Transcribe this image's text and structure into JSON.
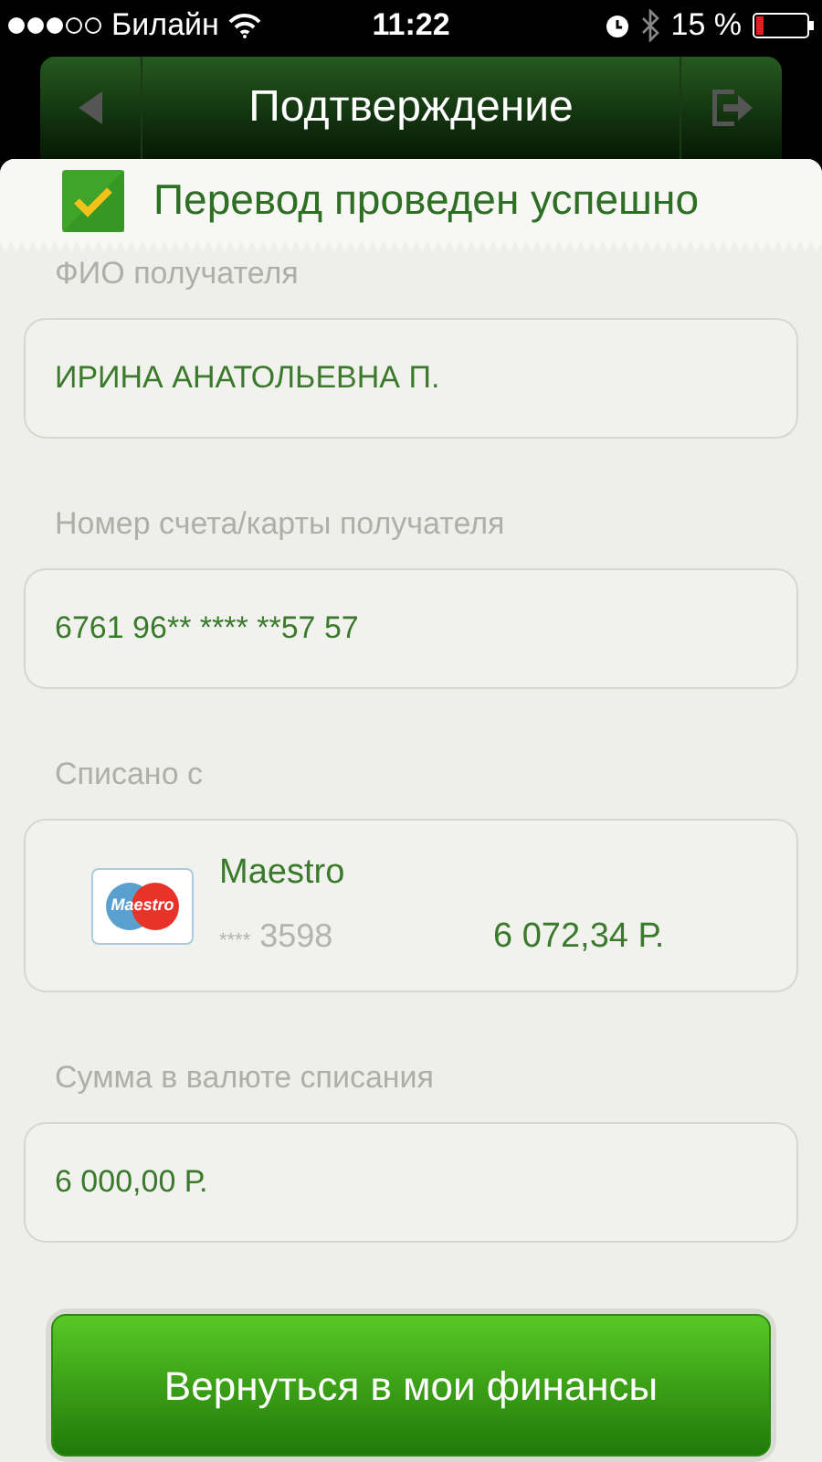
{
  "status_bar": {
    "carrier": "Билайн",
    "time": "11:22",
    "battery": "15 %"
  },
  "nav": {
    "title": "Подтверждение"
  },
  "banner": {
    "text": "Перевод проведен успешно"
  },
  "sections": [
    {
      "kind": "text",
      "label": "ФИО получателя",
      "value": "ИРИНА АНАТОЛЬЕВНА П."
    },
    {
      "kind": "text",
      "label": "Номер счета/карты получателя",
      "value": "6761 96** **** **57 57"
    },
    {
      "kind": "card",
      "label": "Списано с",
      "logo_text": "Maestro",
      "card_name": "Maestro",
      "card_mask": "****",
      "card_last": "3598",
      "balance": "6 072,34 Р."
    },
    {
      "kind": "text",
      "label": "Сумма в валюте списания",
      "value": "6 000,00 Р."
    }
  ],
  "button": {
    "label": "Вернуться в мои финансы"
  }
}
